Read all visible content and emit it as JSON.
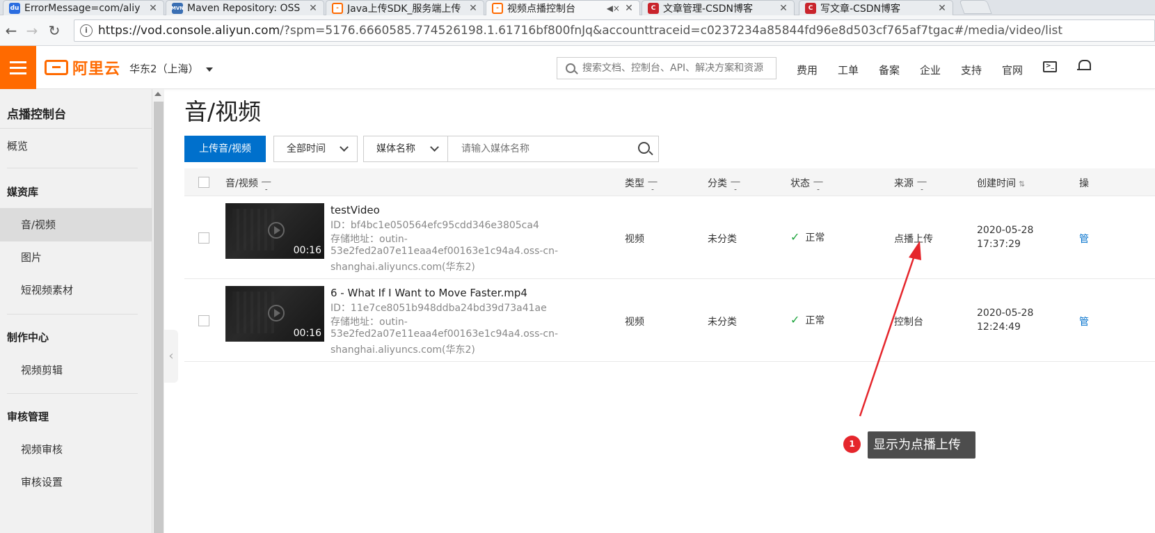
{
  "browser": {
    "tabs": [
      {
        "title": "ErrorMessage=com/aliy",
        "active": false
      },
      {
        "title": "Maven Repository: OSS",
        "active": false
      },
      {
        "title": "Java上传SDK_服务端上传",
        "active": false
      },
      {
        "title": "视频点播控制台",
        "active": true
      },
      {
        "title": "文章管理-CSDN博客",
        "active": false
      },
      {
        "title": "写文章-CSDN博客",
        "active": false
      }
    ],
    "url_host": "https://vod.console.aliyun.com",
    "url_rest": "/?spm=5176.6660585.774526198.1.61716bf800fnJq&accounttraceid=c0237234a85844fd96e8d503cf765af7tgac#/media/video/list"
  },
  "topbar": {
    "logo_text": "阿里云",
    "region": "华东2（上海）",
    "search_placeholder": "搜索文档、控制台、API、解决方案和资源",
    "links": [
      "费用",
      "工单",
      "备案",
      "企业",
      "支持",
      "官网"
    ],
    "brand_color": "#ff6a00"
  },
  "sidebar": {
    "title": "点播控制台",
    "items": {
      "overview": "概览",
      "media_group": "媒资库",
      "audio_video": "音/视频",
      "images": "图片",
      "short_video": "短视频素材",
      "production_group": "制作中心",
      "video_edit": "视频剪辑",
      "review_group": "审核管理",
      "video_review": "视频审核",
      "review_settings": "审核设置"
    }
  },
  "main": {
    "page_title": "音/视频",
    "upload_label": "上传音/视频",
    "time_filter": "全部时间",
    "name_filter": "媒体名称",
    "name_placeholder": "请输入媒体名称",
    "columns": {
      "media": "音/视频",
      "type": "类型",
      "category": "分类",
      "status": "状态",
      "source": "来源",
      "created": "创建时间",
      "ops": "操"
    },
    "rows": [
      {
        "duration": "00:16",
        "name": "testVideo",
        "id": "ID：bf4bc1e050564efc95cdd346e3805ca4",
        "storage_1": "存储地址：outin-",
        "storage_2": "53e2fed2a07e11eaa4ef00163e1c94a4.oss-cn-",
        "storage_3": "shanghai.aliyuncs.com(华东2)",
        "type": "视频",
        "category": "未分类",
        "status": "正常",
        "source": "点播上传",
        "date": "2020-05-28",
        "time": "17:37:29",
        "op": "管"
      },
      {
        "duration": "00:16",
        "name": "6 - What If I Want to Move Faster.mp4",
        "id": "ID：11e7ce8051b948ddba24bd39d73a41ae",
        "storage_1": "存储地址：outin-",
        "storage_2": "53e2fed2a07e11eaa4ef00163e1c94a4.oss-cn-",
        "storage_3": "shanghai.aliyuncs.com(华东2)",
        "type": "视频",
        "category": "未分类",
        "status": "正常",
        "source": "控制台",
        "date": "2020-05-28",
        "time": "12:24:49",
        "op": "管"
      }
    ],
    "accent_color": "#0070cc",
    "status_color": "#1aa33a"
  },
  "annotation": {
    "number": "1",
    "text": "显示为点播上传",
    "color": "#e5262c"
  }
}
